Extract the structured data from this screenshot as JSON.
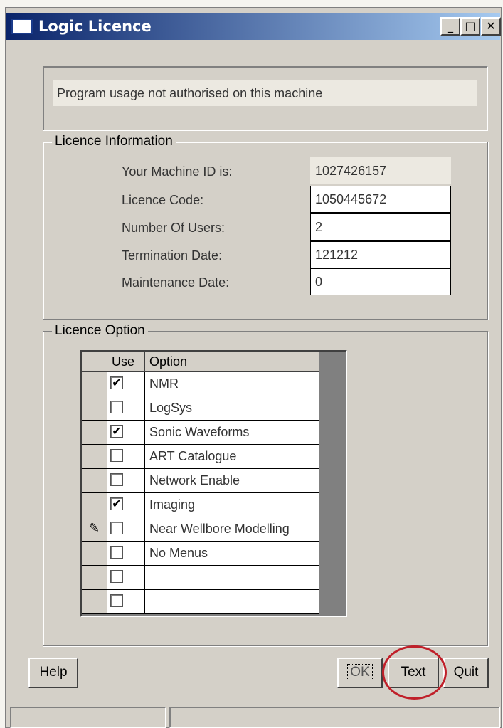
{
  "window": {
    "title": "Logic Licence",
    "minimize_glyph": "_",
    "maximize_glyph": "□",
    "close_glyph": "✕"
  },
  "message": "Program usage not authorised on this machine",
  "licence_info": {
    "legend": "Licence Information",
    "rows": [
      {
        "label": "Your Machine ID is:",
        "value": "1027426157",
        "editable": false
      },
      {
        "label": "Licence Code:",
        "value": "1050445672",
        "editable": true
      },
      {
        "label": "Number Of Users:",
        "value": "2",
        "editable": true
      },
      {
        "label": "Termination Date:",
        "value": "121212",
        "editable": true
      },
      {
        "label": "Maintenance Date:",
        "value": "0",
        "editable": true
      }
    ]
  },
  "licence_option": {
    "legend": "Licence Option",
    "headers": {
      "use": "Use",
      "option": "Option"
    },
    "rows": [
      {
        "checked": true,
        "option": "NMR"
      },
      {
        "checked": false,
        "option": "LogSys"
      },
      {
        "checked": true,
        "option": "Sonic Waveforms"
      },
      {
        "checked": false,
        "option": "ART Catalogue"
      },
      {
        "checked": false,
        "option": "Network Enable"
      },
      {
        "checked": true,
        "option": "Imaging"
      },
      {
        "checked": false,
        "option": "Near Wellbore Modelling",
        "editing": true
      },
      {
        "checked": false,
        "option": "No Menus"
      },
      {
        "checked": false,
        "option": ""
      },
      {
        "checked": false,
        "option": ""
      }
    ]
  },
  "buttons": {
    "help": "Help",
    "ok": "OK",
    "text": "Text",
    "quit": "Quit"
  },
  "colors": {
    "title_start": "#0a246a",
    "title_end": "#a6caf0",
    "annotation_circle": "#c0202a",
    "face": "#d4d0c8"
  }
}
